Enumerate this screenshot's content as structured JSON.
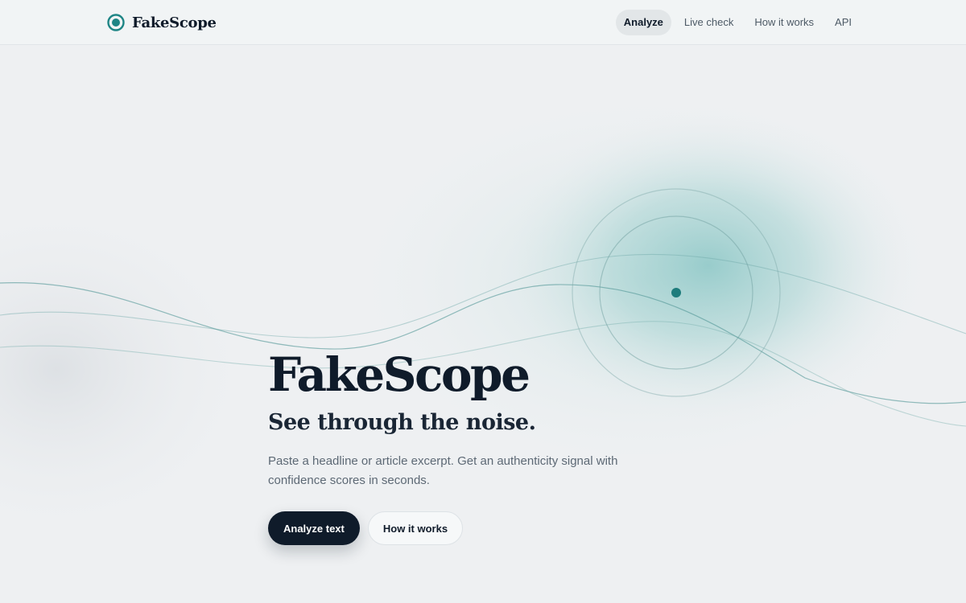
{
  "brand": {
    "name": "FakeScope",
    "logo_icon": "target-dot-icon",
    "accent": "#1e8585"
  },
  "nav": {
    "items": [
      {
        "label": "Analyze",
        "active": true
      },
      {
        "label": "Live check",
        "active": false
      },
      {
        "label": "How it works",
        "active": false
      },
      {
        "label": "API",
        "active": false
      }
    ]
  },
  "hero": {
    "title": "FakeScope",
    "tagline": "See through the noise.",
    "description": "Paste a headline or article excerpt. Get an authenticity signal with confidence scores in seconds.",
    "primary_button": "Analyze text",
    "secondary_button": "How it works"
  },
  "colors": {
    "background": "#eef0f2",
    "ink": "#0f1b2a",
    "teal": "#1e8585",
    "muted_text": "#5d6975"
  }
}
